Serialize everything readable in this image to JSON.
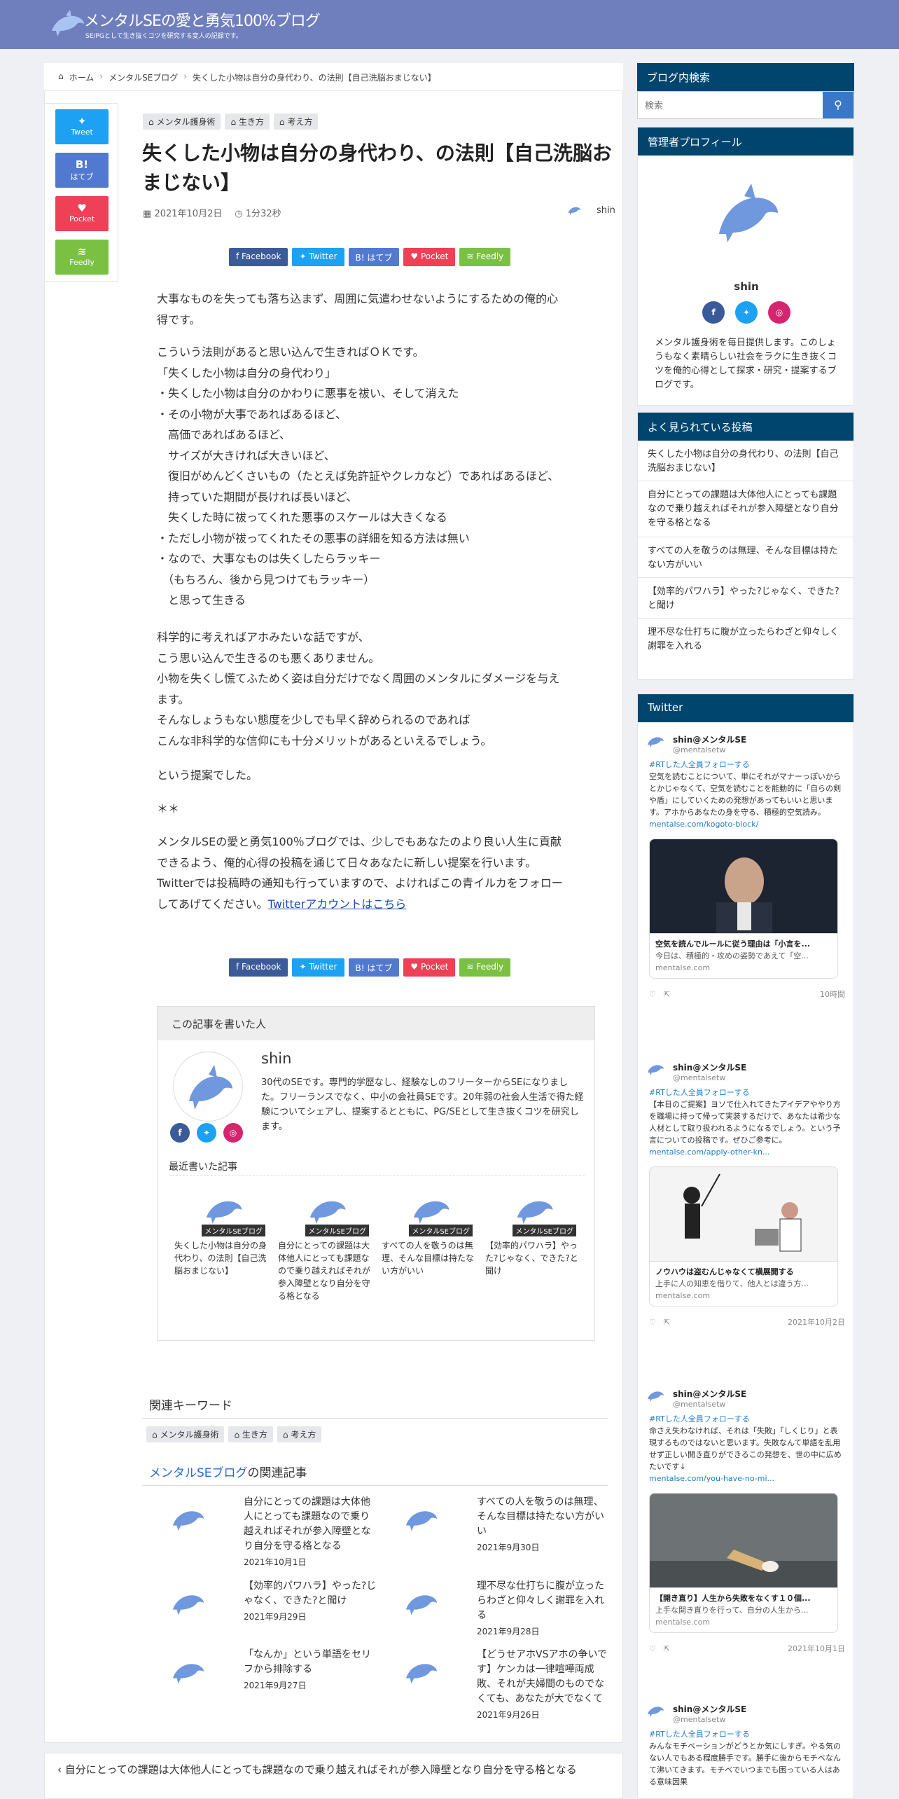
{
  "site": {
    "title": "メンタルSEの愛と勇気100%ブログ",
    "subtitle": "SE/PGとして生き抜くコツを研究する変人の記録です。"
  },
  "breadcrumb": [
    "ホーム",
    "メンタルSEブログ",
    "失くした小物は自分の身代わり、の法則【自己洗脳おまじない】"
  ],
  "share_vertical": [
    {
      "icon": "twitter-icon",
      "label": "Tweet"
    },
    {
      "icon": "hatena-icon",
      "label": "はてブ",
      "glyph": "B!"
    },
    {
      "icon": "pocket-icon",
      "label": "Pocket"
    },
    {
      "icon": "feedly-icon",
      "label": "Feedly"
    }
  ],
  "article": {
    "tags": [
      "メンタル護身術",
      "生き方",
      "考え方"
    ],
    "title": "失くした小物は自分の身代わり、の法則【自己洗脳おまじない】",
    "date": "2021年10月2日",
    "read_time": "1分32秒",
    "author": "shin",
    "share": [
      "Facebook",
      "Twitter",
      "はてブ",
      "Pocket",
      "Feedly"
    ],
    "paragraphs": [
      [
        "大事なものを失っても落ち込まず、周囲に気遣わせないようにするための俺的心",
        "得です。"
      ],
      [
        "こういう法則があると思い込んで生きればＯＫです。",
        "「失くした小物は自分の身代わり」",
        "・失くした小物は自分のかわりに悪事を祓い、そして消えた",
        "・その小物が大事であればあるほど、",
        "　高価であればあるほど、",
        "　サイズが大きければ大きいほど、",
        "　復旧がめんどくさいもの（たとえば免許証やクレカなど）であればあるほど、",
        "　持っていた期間が長ければ長いほど、",
        "　失くした時に祓ってくれた悪事のスケールは大きくなる",
        "・ただし小物が祓ってくれたその悪事の詳細を知る方法は無い",
        "・なので、大事なものは失くしたらラッキー",
        "　（もちろん、後から見つけてもラッキー）",
        "　と思って生きる"
      ],
      [
        "科学的に考えればアホみたいな話ですが、",
        "こう思い込んで生きるのも悪くありません。",
        "小物を失くし慌てふためく姿は自分だけでなく周囲のメンタルにダメージを与え",
        "ます。",
        "そんなしょうもない態度を少しでも早く辞められるのであれば",
        "こんな非科学的な信仰にも十分メリットがあるといえるでしょう。"
      ],
      [
        "という提案でした。"
      ],
      [
        "＊＊"
      ],
      [
        "メンタルSEの愛と勇気100％ブログでは、少しでもあなたのより良い人生に貢献",
        "できるよう、俺的心得の投稿を通じて日々あなたに新しい提案を行います。",
        "Twitterでは投稿時の通知も行っていますので、よければこの青イルカをフォロー",
        "してあげてください。"
      ]
    ],
    "twitter_link": "Twitterアカウントはこちら"
  },
  "author_box": {
    "heading": "この記事を書いた人",
    "name": "shin",
    "description": "30代のSEです。専門的学歴なし、経験なしのフリーターからSEになりました。フリーランスでなく、中小の会社員SEです。20年弱の社会人生活で得た経験についてシェアし、提案するとともに、PG/SEとして生き抜くコツを研究します。",
    "recent_heading": "最近書いた記事",
    "recent": [
      {
        "badge": "メンタルSEブログ",
        "title": "失くした小物は自分の身代わり、の法則【自己洗脳おまじない】"
      },
      {
        "badge": "メンタルSEブログ",
        "title": "自分にとっての課題は大体他人にとっても課題なので乗り越えればそれが参入障壁となり自分を守る格となる"
      },
      {
        "badge": "メンタルSEブログ",
        "title": "すべての人を敬うのは無理、そんな目標は持たない方がいい"
      },
      {
        "badge": "メンタルSEブログ",
        "title": "【効率的パワハラ】やった?じゃなく、できた?と聞け"
      }
    ]
  },
  "keywords": {
    "heading": "関連キーワード",
    "tags": [
      "メンタル護身術",
      "生き方",
      "考え方"
    ]
  },
  "related": {
    "heading_link": "メンタルSEブログ",
    "heading_rest": "の関連記事",
    "items": [
      {
        "title": "自分にとっての課題は大体他人にとっても課題なので乗り越えればそれが参入障壁となり自分を守る格となる",
        "date": "2021年10月1日"
      },
      {
        "title": "すべての人を敬うのは無理、そんな目標は持たない方がいい",
        "date": "2021年9月30日"
      },
      {
        "title": "【効率的パワハラ】やった?じゃなく、できた?と聞け",
        "date": "2021年9月29日"
      },
      {
        "title": "理不尽な仕打ちに腹が立ったらわざと仰々しく謝罪を入れる",
        "date": "2021年9月28日"
      },
      {
        "title": "「なんか」という単語をセリフから排除する",
        "date": "2021年9月27日"
      },
      {
        "title": "【どうせアホVSアホの争いです】ケンカは一律喧嘩両成敗、それが夫婦間のものでなくても、あなたが大でなくて",
        "date": "2021年9月26日"
      }
    ]
  },
  "next_post": "自分にとっての課題は大体他人にとっても課題なので乗り越えればそれが参入障壁となり自分を守る格となる",
  "sidebar": {
    "search": {
      "heading": "ブログ内検索",
      "placeholder": "検索"
    },
    "profile": {
      "heading": "管理者プロフィール",
      "name": "shin",
      "description": "メンタル護身術を毎日提供します。このしょうもなく素晴らしい社会をラクに生き抜くコツを俺的心得として探求・研究・提案するブログです。"
    },
    "popular": {
      "heading": "よく見られている投稿",
      "items": [
        "失くした小物は自分の身代わり、の法則【自己洗脳おまじない】",
        "自分にとっての課題は大体他人にとっても課題なので乗り越えればそれが参入障壁となり自分を守る格となる",
        "すべての人を敬うのは無理、そんな目標は持たない方がいい",
        "【効率的パワハラ】やった?じゃなく、できた?と聞け",
        "理不尽な仕打ちに腹が立ったらわざと仰々しく謝罪を入れる"
      ]
    },
    "twitter": {
      "heading": "Twitter",
      "tweets": [
        {
          "name": "shin@メンタルSE",
          "handle": "@mentalsetw",
          "lead": "#RTした人全員フォローする",
          "text": "空気を読むことについて、単にそれがマナーっぽいからとかじゃなくて、空気を読むことを能動的に「自らの剣や盾」にしていくための発想があってもいいと思います。アホからあなたの身を守る、積極的空気読み。",
          "url": "mentalse.com/kogoto-block/",
          "card_title": "空気を読んでルールに従う理由は「小言を...",
          "card_desc": "今日は、積極的・攻めの姿勢であえて「空...",
          "card_domain": "mentalse.com",
          "time": "10時間"
        },
        {
          "name": "shin@メンタルSE",
          "handle": "@mentalsetw",
          "lead": "#RTした人全員フォローする",
          "text": "【本日のご提案】ヨソで仕入れてきたアイデアややり方を職場に持って帰って実装するだけで、あなたは希少な人材として取り扱われるようになるでしょう。という予言についての投稿です。ぜひご参考に。",
          "url": "mentalse.com/apply-other-kn...",
          "card_title": "ノウハウは盗むんじゃなくて横展開する",
          "card_desc": "上手に人の知恵を借りて、他人とは違う方...",
          "card_domain": "mentalse.com",
          "time": "2021年10月2日"
        },
        {
          "name": "shin@メンタルSE",
          "handle": "@mentalsetw",
          "lead": "#RTした人全員フォローする",
          "text": "命さえ失わなければ、それは「失敗」「しくじり」と表現するものではないと思います。失敗なんて単語を乱用せず正しい開き直りができるこの発想を、世の中に広めたいです↓",
          "url": "mentalse.com/you-have-no-mi...",
          "card_title": "【開き直り】人生から失敗をなくす１０個...",
          "card_desc": "上手な開き直りを行って、自分の人生から...",
          "card_domain": "mentalse.com",
          "time": "2021年10月1日"
        },
        {
          "name": "shin@メンタルSE",
          "handle": "@mentalsetw",
          "lead": "#RTした人全員フォローする",
          "text": "みんなモチベーションがどうとか気にしすぎ。やる気のない人でもある程度勝手です。勝手に後からモチベなんて沸いてきます。モチベでいつまでも困っている人はある意味因果"
        }
      ]
    }
  },
  "colors": {
    "header": "#6f7fbe",
    "sidebar_heading": "#00456e",
    "accent": "#3a77c8"
  }
}
